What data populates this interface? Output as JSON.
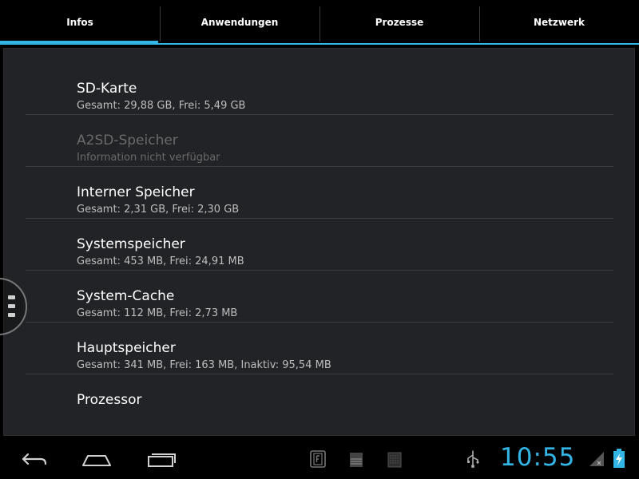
{
  "tabs": [
    {
      "label": "Infos",
      "active": true
    },
    {
      "label": "Anwendungen",
      "active": false
    },
    {
      "label": "Prozesse",
      "active": false
    },
    {
      "label": "Netzwerk",
      "active": false
    }
  ],
  "items": [
    {
      "title": "SD-Karte",
      "subtitle": "Gesamt: 29,88 GB, Frei: 5,49 GB",
      "enabled": true
    },
    {
      "title": "A2SD-Speicher",
      "subtitle": "Information nicht verfügbar",
      "enabled": false
    },
    {
      "title": "Interner Speicher",
      "subtitle": "Gesamt: 2,31 GB, Frei: 2,30 GB",
      "enabled": true
    },
    {
      "title": "Systemspeicher",
      "subtitle": "Gesamt: 453 MB, Frei: 24,91 MB",
      "enabled": true
    },
    {
      "title": "System-Cache",
      "subtitle": "Gesamt: 112 MB, Frei: 2,73 MB",
      "enabled": true
    },
    {
      "title": "Hauptspeicher",
      "subtitle": "Gesamt: 341 MB, Frei: 163 MB, Inaktiv: 95,54 MB",
      "enabled": true
    },
    {
      "title": "Prozessor",
      "subtitle": "",
      "enabled": true
    }
  ],
  "status": {
    "time": "10:55",
    "accent_color": "#33b5e5",
    "icons": [
      "usb-icon",
      "no-signal-icon",
      "battery-charging-icon"
    ]
  },
  "navigation": {
    "buttons": [
      "back-icon",
      "home-icon",
      "recent-apps-icon"
    ],
    "notification_icons": [
      "app-notification-icon",
      "storage-notification-icon",
      "sd-notification-icon"
    ]
  }
}
